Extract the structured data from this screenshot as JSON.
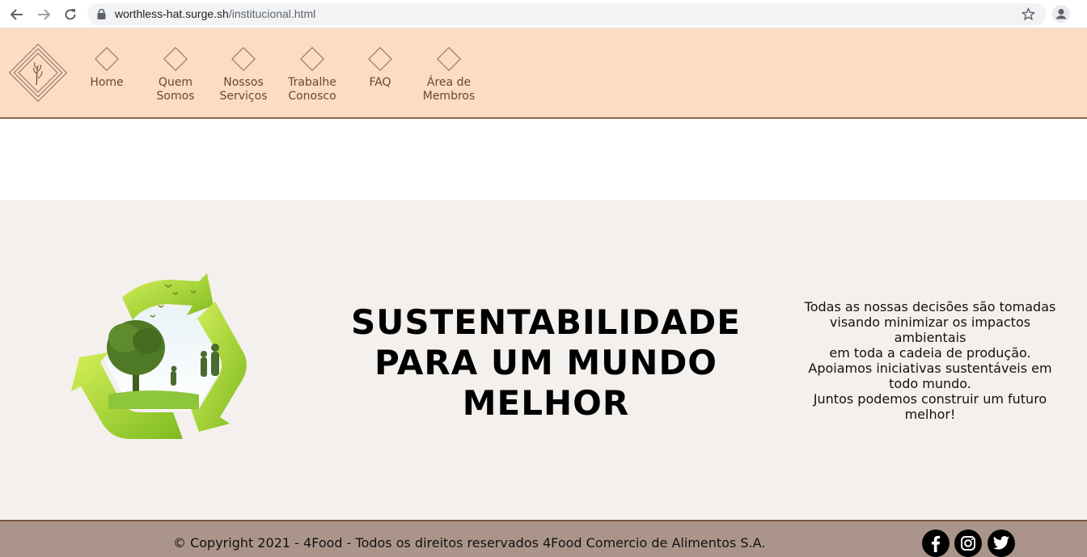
{
  "browser": {
    "url_host": "worthless-hat.surge.sh",
    "url_path": "/institucional.html",
    "icons": [
      "back-arrow-icon",
      "forward-arrow-icon",
      "reload-icon",
      "lock-icon",
      "star-icon",
      "profile-icon"
    ]
  },
  "header": {
    "background_color": "#fedbc3",
    "border_color": "#8d6249",
    "menu": [
      {
        "label": "Home"
      },
      {
        "label": "Quem\nSomos"
      },
      {
        "label": "Nossos\nServiços"
      },
      {
        "label": "Trabalhe\nConosco"
      },
      {
        "label": "FAQ"
      },
      {
        "label": "Área de\nMembros"
      }
    ]
  },
  "hero": {
    "background_color": "#f4f0ed",
    "title": "SUSTENTABILIDADE PARA UM MUNDO MELHOR",
    "text_lines": [
      "Todas as nossas decisões são tomadas visando minimizar os impactos ambientais",
      "em toda a cadeia de produção.",
      "Apoiamos iniciativas sustentáveis em todo mundo.",
      "Juntos podemos construir um futuro melhor!"
    ]
  },
  "footer": {
    "background_color": "#ab958b",
    "copyright": "© Copyright 2021 - 4Food - Todos os direitos reservados 4Food Comercio de Alimentos S.A.",
    "social": [
      "facebook-icon",
      "instagram-icon",
      "twitter-icon"
    ]
  }
}
